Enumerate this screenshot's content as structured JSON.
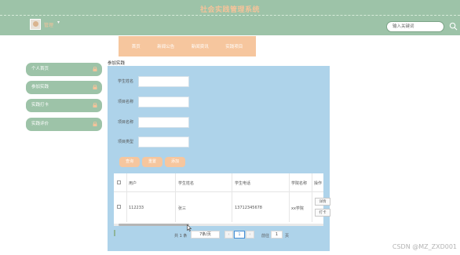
{
  "header": {
    "title": "社会实践管理系统",
    "username": "管理",
    "user_caret": "▾",
    "search_placeholder": "输入关键词",
    "search_icon": "search-icon"
  },
  "topnav": [
    "首页",
    "新闻公告",
    "新闻资讯",
    "实践项目"
  ],
  "sidebar": [
    {
      "label": "个人首页",
      "icon": "lock-icon"
    },
    {
      "label": "参加实践",
      "icon": "lock-icon"
    },
    {
      "label": "实践打卡",
      "icon": "lock-icon"
    },
    {
      "label": "实践评价",
      "icon": "lock-icon"
    }
  ],
  "panel": {
    "label": "参加实践",
    "form": [
      {
        "label": "学生姓名",
        "value": ""
      },
      {
        "label": "项目名称",
        "value": ""
      },
      {
        "label": "项目名称",
        "value": ""
      },
      {
        "label": "项目类型",
        "value": ""
      }
    ],
    "buttons": [
      "查询",
      "重置",
      "添加"
    ]
  },
  "table": {
    "columns": [
      "用户",
      "学生姓名",
      "学生电话",
      "学院名称",
      "操作"
    ],
    "rows": [
      {
        "user": "112233",
        "name": "张三",
        "phone": "13712345678",
        "college": "xx学院",
        "ops": [
          "详情",
          "打卡"
        ]
      }
    ]
  },
  "pagination": {
    "total": "共 1 条",
    "page_size": "7条/页",
    "prev": "‹",
    "page": "1",
    "next": "›",
    "goto_label": "前往",
    "goto_value": "1",
    "page_unit": "页"
  },
  "watermark": "CSDN @MZ_ZXD001"
}
